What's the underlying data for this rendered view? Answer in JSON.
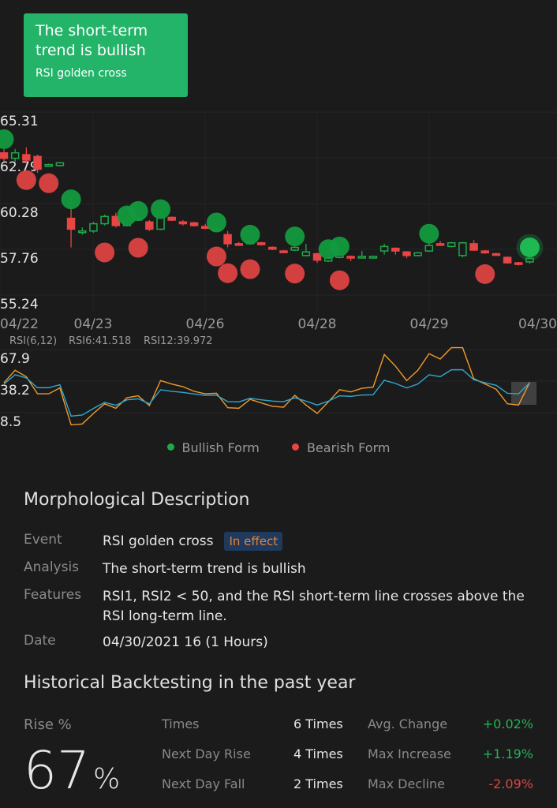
{
  "banner": {
    "title": "The short-term trend is bullish",
    "subtitle": "RSI golden cross",
    "color": "#23b46a"
  },
  "chart_data": [
    {
      "type": "candlestick",
      "ylim": [
        55.24,
        65.31
      ],
      "yticks": [
        "65.31",
        "62.79",
        "60.28",
        "57.76",
        "55.24"
      ],
      "xticks": [
        "04/22",
        "04/23",
        "04/26",
        "04/28",
        "04/29",
        "04/30"
      ],
      "up_color": "#1faa4a",
      "down_color": "#e84545",
      "candles": [
        [
          63.5,
          63.2,
          63.7,
          63.0
        ],
        [
          63.2,
          63.5,
          63.7,
          63.0
        ],
        [
          63.4,
          63.1,
          63.8,
          62.9
        ],
        [
          63.3,
          62.6,
          63.4,
          62.4
        ],
        [
          62.8,
          62.85,
          62.9,
          62.75
        ],
        [
          62.8,
          62.95,
          63.0,
          62.75
        ],
        [
          59.9,
          59.3,
          61.0,
          58.3
        ],
        [
          59.15,
          59.2,
          59.4,
          59.0
        ],
        [
          59.2,
          59.6,
          59.7,
          59.1
        ],
        [
          59.6,
          60.0,
          60.1,
          59.5
        ],
        [
          60.0,
          59.5,
          60.2,
          59.4
        ],
        [
          59.5,
          59.8,
          59.85,
          59.45
        ],
        [
          59.8,
          59.9,
          60.1,
          59.75
        ],
        [
          59.7,
          59.3,
          59.8,
          59.2
        ],
        [
          59.3,
          60.1,
          60.3,
          59.25
        ],
        [
          59.95,
          59.8,
          60.0,
          59.75
        ],
        [
          59.7,
          59.6,
          59.8,
          59.5
        ],
        [
          59.65,
          59.5,
          59.7,
          59.45
        ],
        [
          59.45,
          59.35,
          59.6,
          59.3
        ],
        [
          59.25,
          59.3,
          59.35,
          59.2
        ],
        [
          59.0,
          58.5,
          59.2,
          58.3
        ],
        [
          58.5,
          58.45,
          58.6,
          58.4
        ],
        [
          58.5,
          58.6,
          58.65,
          58.45
        ],
        [
          58.55,
          58.45,
          58.6,
          58.4
        ],
        [
          58.3,
          58.2,
          58.35,
          58.15
        ],
        [
          58.1,
          58.05,
          58.15,
          58.0
        ],
        [
          58.15,
          58.3,
          58.4,
          58.1
        ],
        [
          57.85,
          58.05,
          58.5,
          57.8
        ],
        [
          57.95,
          57.6,
          58.0,
          57.45
        ],
        [
          57.55,
          57.7,
          57.75,
          57.5
        ],
        [
          57.75,
          57.9,
          57.95,
          57.7
        ],
        [
          57.8,
          57.75,
          57.85,
          57.55
        ],
        [
          57.75,
          57.8,
          58.1,
          57.7
        ],
        [
          57.75,
          57.8,
          57.85,
          57.7
        ],
        [
          58.1,
          58.35,
          58.5,
          57.9
        ],
        [
          58.25,
          58.1,
          58.3,
          57.9
        ],
        [
          58.05,
          57.85,
          58.1,
          57.7
        ],
        [
          57.85,
          58.0,
          58.05,
          57.8
        ],
        [
          58.1,
          58.4,
          58.6,
          58.05
        ],
        [
          58.5,
          58.45,
          58.65,
          58.4
        ],
        [
          58.35,
          58.55,
          58.6,
          58.3
        ],
        [
          57.85,
          58.55,
          58.6,
          57.75
        ],
        [
          58.5,
          58.15,
          58.7,
          58.1
        ],
        [
          58.1,
          58.0,
          58.15,
          57.95
        ],
        [
          57.95,
          57.9,
          58.0,
          57.85
        ],
        [
          57.75,
          57.45,
          57.8,
          57.4
        ],
        [
          57.45,
          57.42,
          57.5,
          57.3
        ],
        [
          57.5,
          57.7,
          57.75,
          57.4
        ]
      ],
      "bullish_markers": [
        [
          0,
          64.25
        ],
        [
          6,
          60.94
        ],
        [
          11,
          60.06
        ],
        [
          12,
          60.3
        ],
        [
          14,
          60.4
        ],
        [
          19,
          59.67
        ],
        [
          22,
          59.0
        ],
        [
          26,
          58.9
        ],
        [
          29,
          58.2
        ],
        [
          30,
          58.35
        ],
        [
          38,
          59.05
        ],
        [
          47,
          58.3
        ]
      ],
      "bearish_markers": [
        [
          2,
          62.0
        ],
        [
          4,
          61.83
        ],
        [
          9,
          58.02
        ],
        [
          12,
          58.28
        ],
        [
          19,
          57.8
        ],
        [
          20,
          56.88
        ],
        [
          22,
          57.1
        ],
        [
          26,
          56.86
        ],
        [
          30,
          56.49
        ],
        [
          43,
          56.83
        ]
      ]
    },
    {
      "type": "line",
      "title": "RSI(6,12)",
      "ylim": [
        8.5,
        67.9
      ],
      "yticks": [
        "67.9",
        "38.2",
        "8.5"
      ],
      "series": [
        {
          "name": "RSI6:41.518",
          "color": "#f0992c",
          "values": [
            44.1,
            55.8,
            49.8,
            33.7,
            33.7,
            39.2,
            4.5,
            5.3,
            15.2,
            24.3,
            20.1,
            30.0,
            31.8,
            22.6,
            46.1,
            42.9,
            40.4,
            36.0,
            33.7,
            34.2,
            20.6,
            20.1,
            28.5,
            25.1,
            21.9,
            21.1,
            32.3,
            23.1,
            15.2,
            26.1,
            37.5,
            35.5,
            38.9,
            39.9,
            70.6,
            59.7,
            46.1,
            55.8,
            71.4,
            66.4,
            77.1,
            77.1,
            47.9,
            42.9,
            38.0,
            24.3,
            23.1,
            44.6
          ]
        },
        {
          "name": "RSI12:39.972",
          "color": "#2fa8d0",
          "values": [
            42.9,
            51.6,
            48.6,
            39.4,
            39.4,
            42.2,
            12.7,
            13.7,
            19.9,
            25.6,
            22.9,
            28.0,
            29.0,
            24.3,
            37.5,
            36.0,
            35.0,
            33.5,
            32.3,
            32.3,
            26.3,
            26.1,
            29.5,
            28.0,
            26.8,
            26.3,
            30.0,
            26.8,
            23.1,
            26.8,
            31.8,
            31.3,
            32.5,
            32.8,
            46.4,
            43.4,
            39.2,
            42.9,
            51.6,
            49.8,
            56.3,
            56.3,
            46.9,
            44.1,
            41.7,
            34.2,
            33.7,
            44.1
          ]
        }
      ]
    }
  ],
  "legend": {
    "bullish": "Bullish Form",
    "bearish": "Bearish Form",
    "bullish_color": "#1faa4a",
    "bearish_color": "#e84545"
  },
  "description": {
    "title": "Morphological Description",
    "event_label": "Event",
    "event": "RSI golden cross",
    "status": "In effect",
    "analysis_label": "Analysis",
    "analysis": "The short-term trend is bullish",
    "features_label": "Features",
    "features": "RSI1, RSI2 < 50, and the RSI short-term line crosses above the RSI long-term line.",
    "date_label": "Date",
    "date": "04/30/2021  16 (1 Hours)"
  },
  "backtest": {
    "title": "Historical Backtesting in the past year",
    "rise_label": "Rise %",
    "rise_value": "67",
    "rise_unit": "%",
    "stats": [
      {
        "label": "Times",
        "value": "6 Times"
      },
      {
        "label": "Next Day Rise",
        "value": "4 Times"
      },
      {
        "label": "Next Day Fall",
        "value": "2 Times"
      }
    ],
    "changes": [
      {
        "label": "Avg. Change",
        "value": "+0.02%",
        "color": "#22b455"
      },
      {
        "label": "Max Increase",
        "value": "+1.19%",
        "color": "#22b455"
      },
      {
        "label": "Max Decline",
        "value": "-2.09%",
        "color": "#e04545"
      }
    ]
  }
}
